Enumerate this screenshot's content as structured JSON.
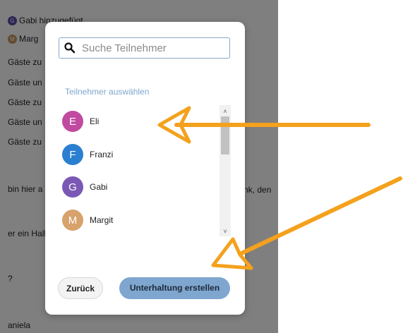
{
  "background": {
    "lines": [
      {
        "avatar": "G",
        "avatar_color": "#5b49a8",
        "text": "Gabi   hinzugefügt"
      },
      {
        "avatar": "M",
        "avatar_color": "#c9965d",
        "text": "Marg"
      },
      {
        "text": "Gäste zu"
      },
      {
        "text": "Gäste un"
      },
      {
        "text": "Gäste zu"
      },
      {
        "text": "Gäste un"
      },
      {
        "text": "Gäste zu"
      },
      {
        "text": "bin hier a"
      },
      {
        "text": "er ein Hall"
      },
      {
        "text": "?"
      },
      {
        "text": "aniela"
      }
    ],
    "right_text": "nk, den"
  },
  "modal": {
    "search": {
      "placeholder": "Suche Teilnehmer",
      "value": ""
    },
    "section_label": "Teilnehmer auswählen",
    "participants": [
      {
        "initial": "E",
        "name": "Eli",
        "color": "#c04aa0"
      },
      {
        "initial": "F",
        "name": "Franzi",
        "color": "#2b7fd0"
      },
      {
        "initial": "G",
        "name": "Gabi",
        "color": "#7b58b5"
      },
      {
        "initial": "M",
        "name": "Margit",
        "color": "#d7a26c"
      }
    ],
    "scroll_up": "˄",
    "scroll_down": "˅",
    "back_label": "Zurück",
    "create_label": "Unterhaltung erstellen"
  },
  "colors": {
    "annotation_arrow": "#f4a11d"
  }
}
